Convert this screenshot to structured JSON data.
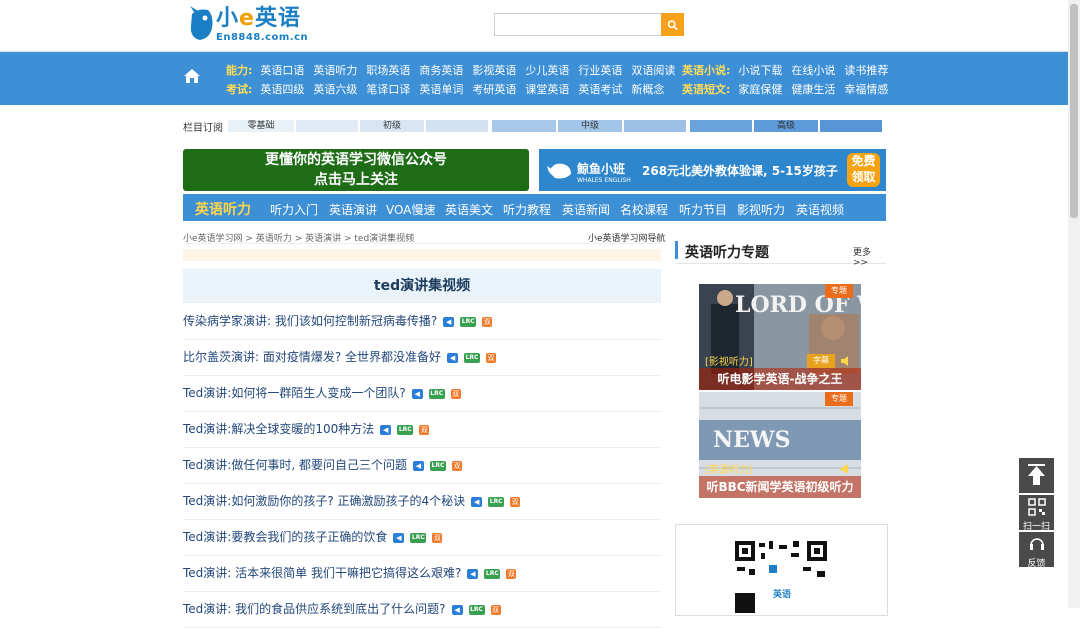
{
  "header": {
    "logo_main_pre": "小",
    "logo_main_e": "e",
    "logo_main_post": "英语",
    "logo_domain": "En8848.com.cn",
    "search_placeholder": ""
  },
  "nav": {
    "row1_label": "能力:",
    "row1_items": [
      "英语口语",
      "英语听力",
      "职场英语",
      "商务英语",
      "影视英语",
      "少儿英语",
      "行业英语",
      "双语阅读"
    ],
    "row1_right_label": "英语小说:",
    "row1_right_items": [
      "小说下载",
      "在线小说",
      "读书推荐"
    ],
    "row2_label": "考试:",
    "row2_items": [
      "英语四级",
      "英语六级",
      "笔译口译",
      "英语单词",
      "考研英语",
      "课堂英语",
      "英语考试",
      "新概念"
    ],
    "row2_right_label": "英语短文:",
    "row2_right_items": [
      "家庭保健",
      "健康生活",
      "幸福情感"
    ]
  },
  "subscribe": {
    "label": "栏目订阅",
    "levels": [
      "零基础",
      "初级",
      "中级",
      "高级"
    ]
  },
  "banners": {
    "green_line1": "更懂你的英语学习微信公众号",
    "green_line2": "点击马上关注",
    "blue_brand": "鲸鱼小班",
    "blue_brand_sub": "WHALES ENGLISH",
    "blue_promo": "268元北美外教体验课, 5-15岁孩子",
    "blue_free_1": "免费",
    "blue_free_2": "领取"
  },
  "listening_bar": {
    "title": "英语听力",
    "items": [
      "听力入门",
      "英语演讲",
      "VOA慢速",
      "英语美文",
      "听力教程",
      "英语新闻",
      "名校课程",
      "听力节目",
      "影视听力",
      "英语视频"
    ]
  },
  "breadcrumb": {
    "items": [
      "小e英语学习网",
      "英语听力",
      "英语演讲",
      "ted演讲集视频"
    ],
    "sep": " > ",
    "right_link": "小e英语学习网导航"
  },
  "list": {
    "heading": "ted演讲集视频",
    "lrc_label": "LRC",
    "bi_label": "双",
    "items": [
      "传染病学家演讲: 我们该如何控制新冠病毒传播?",
      "比尔盖茨演讲: 面对疫情爆发? 全世界都没准备好",
      "Ted演讲:如何将一群陌生人变成一个团队?",
      "Ted演讲:解决全球变暖的100种方法",
      "Ted演讲:做任何事时, 都要问自己三个问题",
      "Ted演讲:如何激励你的孩子? 正确激励孩子的4个秘诀",
      "Ted演讲:要教会我们的孩子正确的饮食",
      "Ted演讲: 活本来很简单 我们干嘛把它搞得这么艰难?",
      "Ted演讲: 我们的食品供应系统到底出了什么问题?"
    ]
  },
  "sidebar": {
    "title": "英语听力专题",
    "more": "更多>>",
    "cards": [
      {
        "caption": "听电影学英语-战争之王",
        "tag": "专题",
        "sub": "[影视听力]",
        "badge": "字幕",
        "art": "LORD OF W...",
        "bg": "#6a7a8a"
      },
      {
        "caption": "听BBC新闻学英语初级听力",
        "tag": "专题",
        "sub": "[英语听力]",
        "badge": "",
        "art": "NEWS",
        "bg": "#5d88b3"
      }
    ],
    "qr_brand": "英语"
  },
  "float_tools": {
    "top_label": "",
    "scan_label": "扫一扫",
    "feedback_label": "反馈"
  },
  "colors": {
    "nav_blue": "#3d8fd6",
    "accent_yellow": "#ffd64a",
    "link_blue": "#24487c",
    "orange": "#f7a21a",
    "green_banner": "#1e6c16"
  }
}
